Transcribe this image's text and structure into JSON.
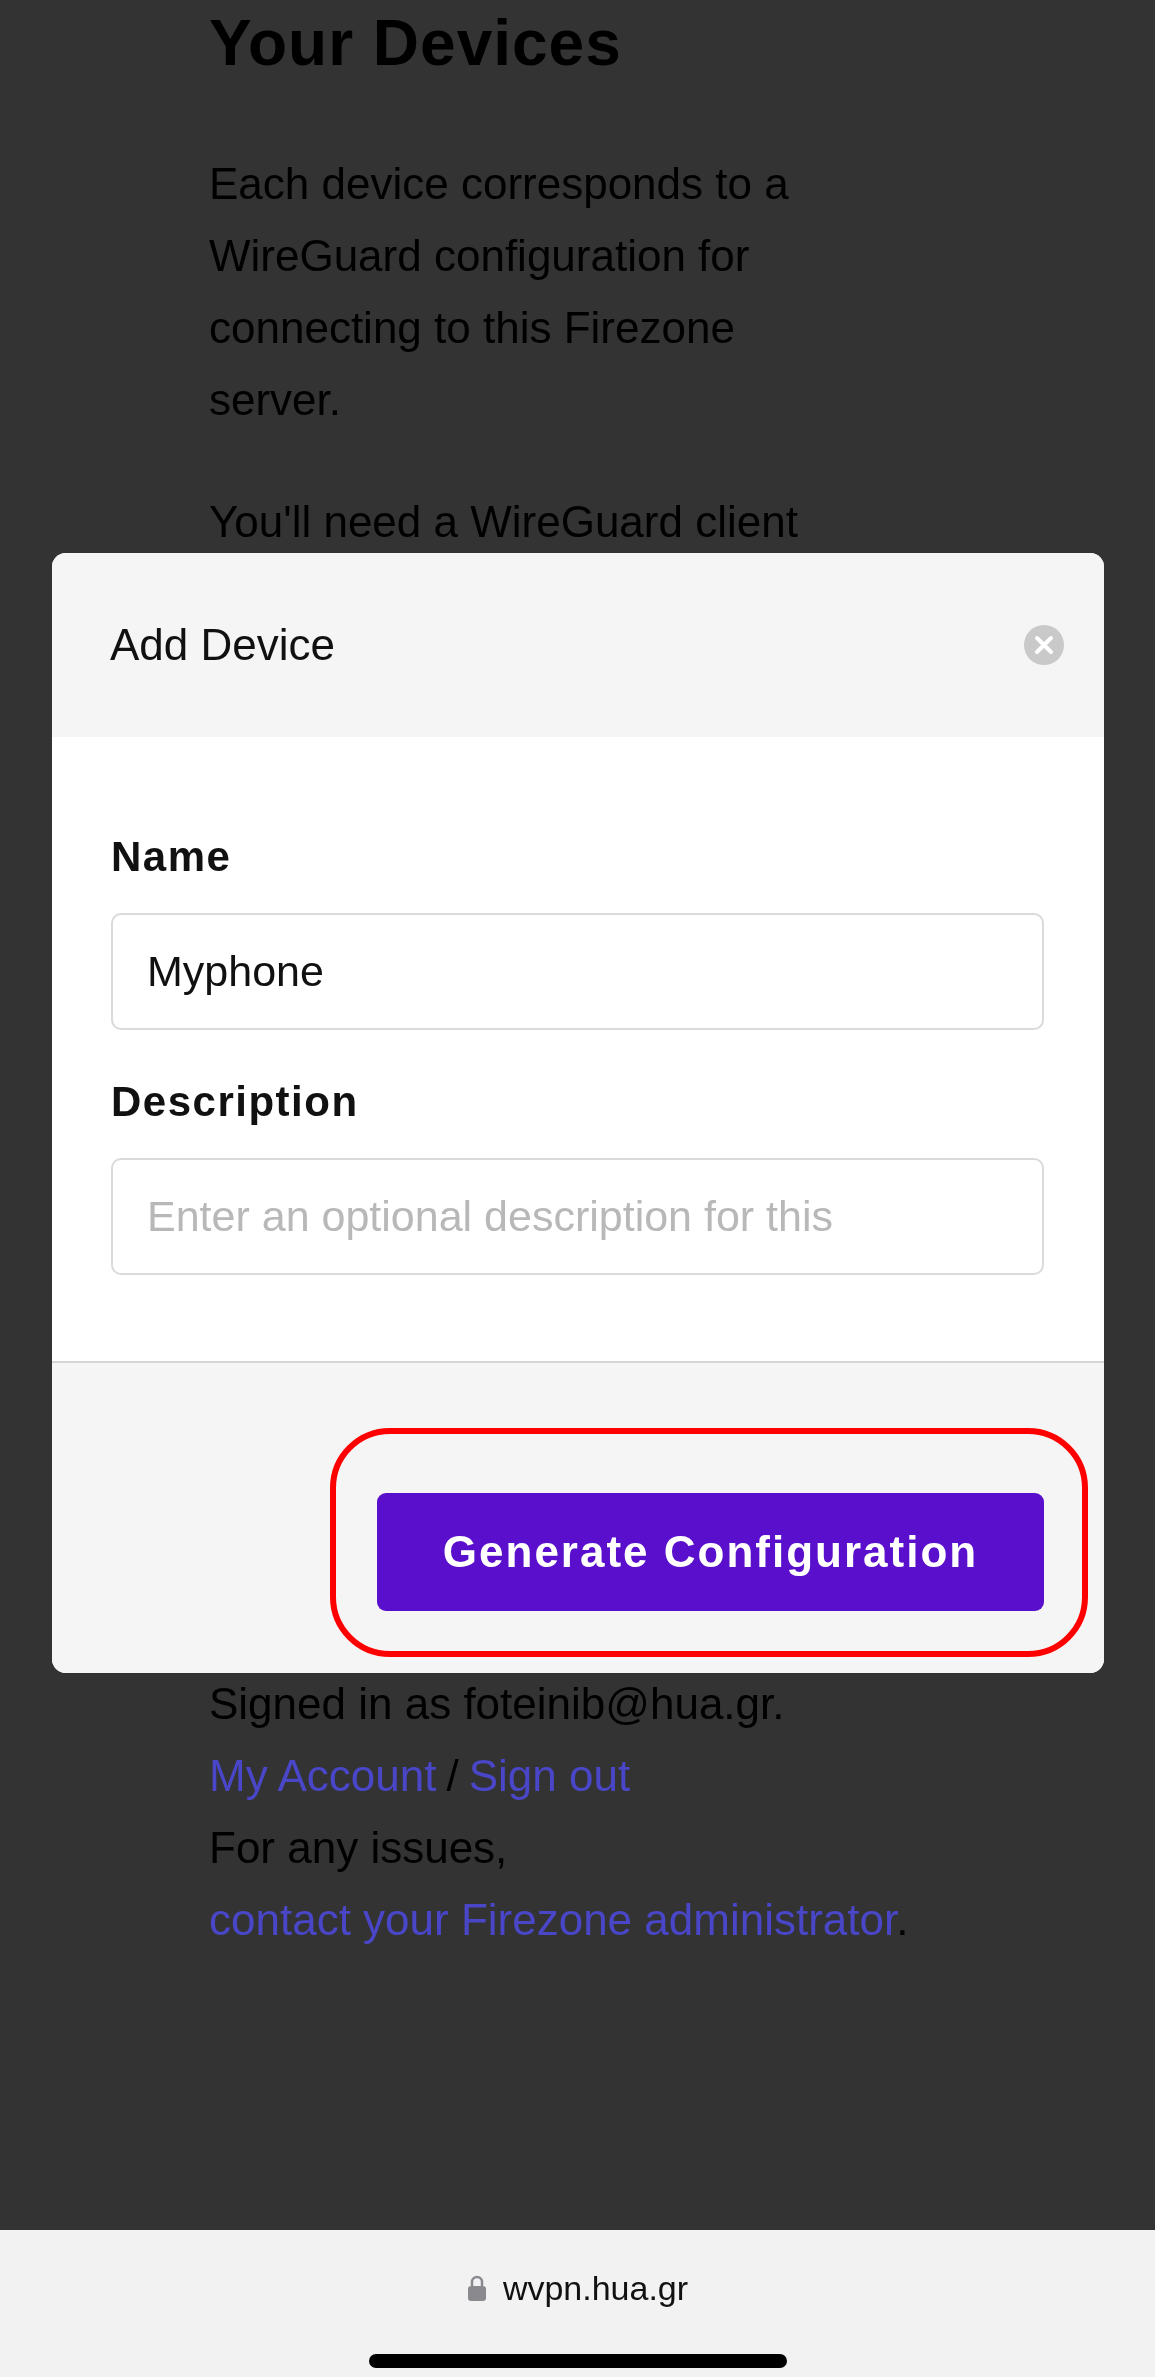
{
  "page": {
    "title": "Your Devices",
    "intro": "Each device corresponds to a WireGuard configuration for connecting to this Firezone server.",
    "client_note": "You'll need a WireGuard client",
    "signed_in": "Signed in as foteinib@hua.gr.",
    "account_link": "My Account",
    "separator": "/",
    "sign_out_link": "Sign out",
    "issues_text": "For any issues,",
    "contact_link": "contact your Firezone administrator",
    "issues_end": "."
  },
  "modal": {
    "title": "Add Device",
    "fields": [
      {
        "label": "Name",
        "value": "Myphone"
      },
      {
        "label": "Description",
        "placeholder": "Enter an optional description for this"
      }
    ],
    "primary_button": "Generate Configuration",
    "highlighted": true
  },
  "browser_bar": {
    "url": "wvpn.hua.gr",
    "secure": true
  }
}
